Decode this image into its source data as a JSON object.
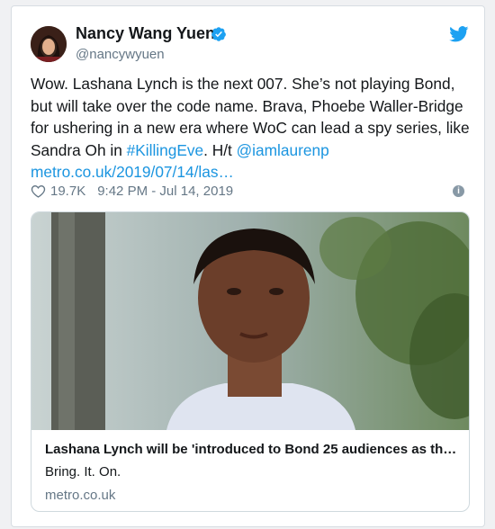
{
  "tweet": {
    "author_name": "Nancy Wang Yuen",
    "handle": "@nancywyuen",
    "text_part1": "Wow. Lashana Lynch is the next 007. She’s not playing Bond, but will take over the code name. Brava, Phoebe Waller-Bridge for ushering in a new era where WoC can lead a spy series, like Sandra Oh in ",
    "hashtag": "#KillingEve",
    "text_part2": ". H/t ",
    "mention": "@iamlaurenp",
    "link": "metro.co.uk/2019/07/14/las…",
    "likes": "19.7K",
    "timestamp": "9:42 PM - Jul 14, 2019",
    "info_icon": "i"
  },
  "link_card": {
    "title": "Lashana Lynch will be 'introduced to Bond 25 audiences as th…",
    "description": "Bring. It. On.",
    "domain": "metro.co.uk"
  },
  "icons": {
    "verified": "verified-badge-icon",
    "bird": "twitter-bird-icon",
    "heart": "heart-icon",
    "info": "info-icon"
  },
  "colors": {
    "accent": "#1b95e0",
    "text": "#14171a",
    "muted": "#657786"
  }
}
